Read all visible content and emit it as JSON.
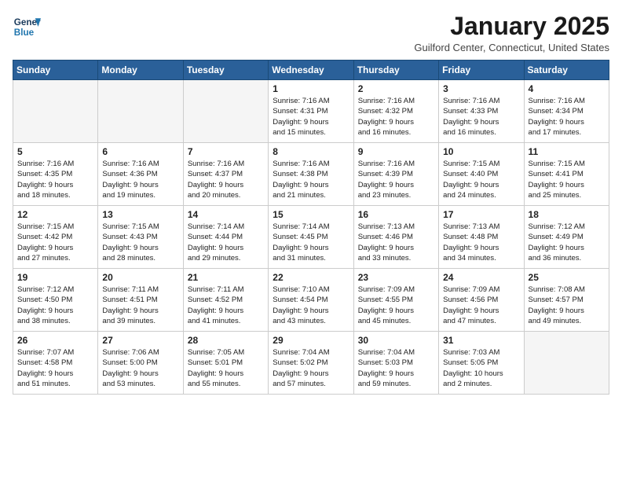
{
  "header": {
    "logo_line1": "General",
    "logo_line2": "Blue",
    "month": "January 2025",
    "location": "Guilford Center, Connecticut, United States"
  },
  "days_of_week": [
    "Sunday",
    "Monday",
    "Tuesday",
    "Wednesday",
    "Thursday",
    "Friday",
    "Saturday"
  ],
  "weeks": [
    [
      {
        "num": "",
        "info": ""
      },
      {
        "num": "",
        "info": ""
      },
      {
        "num": "",
        "info": ""
      },
      {
        "num": "1",
        "info": "Sunrise: 7:16 AM\nSunset: 4:31 PM\nDaylight: 9 hours\nand 15 minutes."
      },
      {
        "num": "2",
        "info": "Sunrise: 7:16 AM\nSunset: 4:32 PM\nDaylight: 9 hours\nand 16 minutes."
      },
      {
        "num": "3",
        "info": "Sunrise: 7:16 AM\nSunset: 4:33 PM\nDaylight: 9 hours\nand 16 minutes."
      },
      {
        "num": "4",
        "info": "Sunrise: 7:16 AM\nSunset: 4:34 PM\nDaylight: 9 hours\nand 17 minutes."
      }
    ],
    [
      {
        "num": "5",
        "info": "Sunrise: 7:16 AM\nSunset: 4:35 PM\nDaylight: 9 hours\nand 18 minutes."
      },
      {
        "num": "6",
        "info": "Sunrise: 7:16 AM\nSunset: 4:36 PM\nDaylight: 9 hours\nand 19 minutes."
      },
      {
        "num": "7",
        "info": "Sunrise: 7:16 AM\nSunset: 4:37 PM\nDaylight: 9 hours\nand 20 minutes."
      },
      {
        "num": "8",
        "info": "Sunrise: 7:16 AM\nSunset: 4:38 PM\nDaylight: 9 hours\nand 21 minutes."
      },
      {
        "num": "9",
        "info": "Sunrise: 7:16 AM\nSunset: 4:39 PM\nDaylight: 9 hours\nand 23 minutes."
      },
      {
        "num": "10",
        "info": "Sunrise: 7:15 AM\nSunset: 4:40 PM\nDaylight: 9 hours\nand 24 minutes."
      },
      {
        "num": "11",
        "info": "Sunrise: 7:15 AM\nSunset: 4:41 PM\nDaylight: 9 hours\nand 25 minutes."
      }
    ],
    [
      {
        "num": "12",
        "info": "Sunrise: 7:15 AM\nSunset: 4:42 PM\nDaylight: 9 hours\nand 27 minutes."
      },
      {
        "num": "13",
        "info": "Sunrise: 7:15 AM\nSunset: 4:43 PM\nDaylight: 9 hours\nand 28 minutes."
      },
      {
        "num": "14",
        "info": "Sunrise: 7:14 AM\nSunset: 4:44 PM\nDaylight: 9 hours\nand 29 minutes."
      },
      {
        "num": "15",
        "info": "Sunrise: 7:14 AM\nSunset: 4:45 PM\nDaylight: 9 hours\nand 31 minutes."
      },
      {
        "num": "16",
        "info": "Sunrise: 7:13 AM\nSunset: 4:46 PM\nDaylight: 9 hours\nand 33 minutes."
      },
      {
        "num": "17",
        "info": "Sunrise: 7:13 AM\nSunset: 4:48 PM\nDaylight: 9 hours\nand 34 minutes."
      },
      {
        "num": "18",
        "info": "Sunrise: 7:12 AM\nSunset: 4:49 PM\nDaylight: 9 hours\nand 36 minutes."
      }
    ],
    [
      {
        "num": "19",
        "info": "Sunrise: 7:12 AM\nSunset: 4:50 PM\nDaylight: 9 hours\nand 38 minutes."
      },
      {
        "num": "20",
        "info": "Sunrise: 7:11 AM\nSunset: 4:51 PM\nDaylight: 9 hours\nand 39 minutes."
      },
      {
        "num": "21",
        "info": "Sunrise: 7:11 AM\nSunset: 4:52 PM\nDaylight: 9 hours\nand 41 minutes."
      },
      {
        "num": "22",
        "info": "Sunrise: 7:10 AM\nSunset: 4:54 PM\nDaylight: 9 hours\nand 43 minutes."
      },
      {
        "num": "23",
        "info": "Sunrise: 7:09 AM\nSunset: 4:55 PM\nDaylight: 9 hours\nand 45 minutes."
      },
      {
        "num": "24",
        "info": "Sunrise: 7:09 AM\nSunset: 4:56 PM\nDaylight: 9 hours\nand 47 minutes."
      },
      {
        "num": "25",
        "info": "Sunrise: 7:08 AM\nSunset: 4:57 PM\nDaylight: 9 hours\nand 49 minutes."
      }
    ],
    [
      {
        "num": "26",
        "info": "Sunrise: 7:07 AM\nSunset: 4:58 PM\nDaylight: 9 hours\nand 51 minutes."
      },
      {
        "num": "27",
        "info": "Sunrise: 7:06 AM\nSunset: 5:00 PM\nDaylight: 9 hours\nand 53 minutes."
      },
      {
        "num": "28",
        "info": "Sunrise: 7:05 AM\nSunset: 5:01 PM\nDaylight: 9 hours\nand 55 minutes."
      },
      {
        "num": "29",
        "info": "Sunrise: 7:04 AM\nSunset: 5:02 PM\nDaylight: 9 hours\nand 57 minutes."
      },
      {
        "num": "30",
        "info": "Sunrise: 7:04 AM\nSunset: 5:03 PM\nDaylight: 9 hours\nand 59 minutes."
      },
      {
        "num": "31",
        "info": "Sunrise: 7:03 AM\nSunset: 5:05 PM\nDaylight: 10 hours\nand 2 minutes."
      },
      {
        "num": "",
        "info": ""
      }
    ]
  ]
}
